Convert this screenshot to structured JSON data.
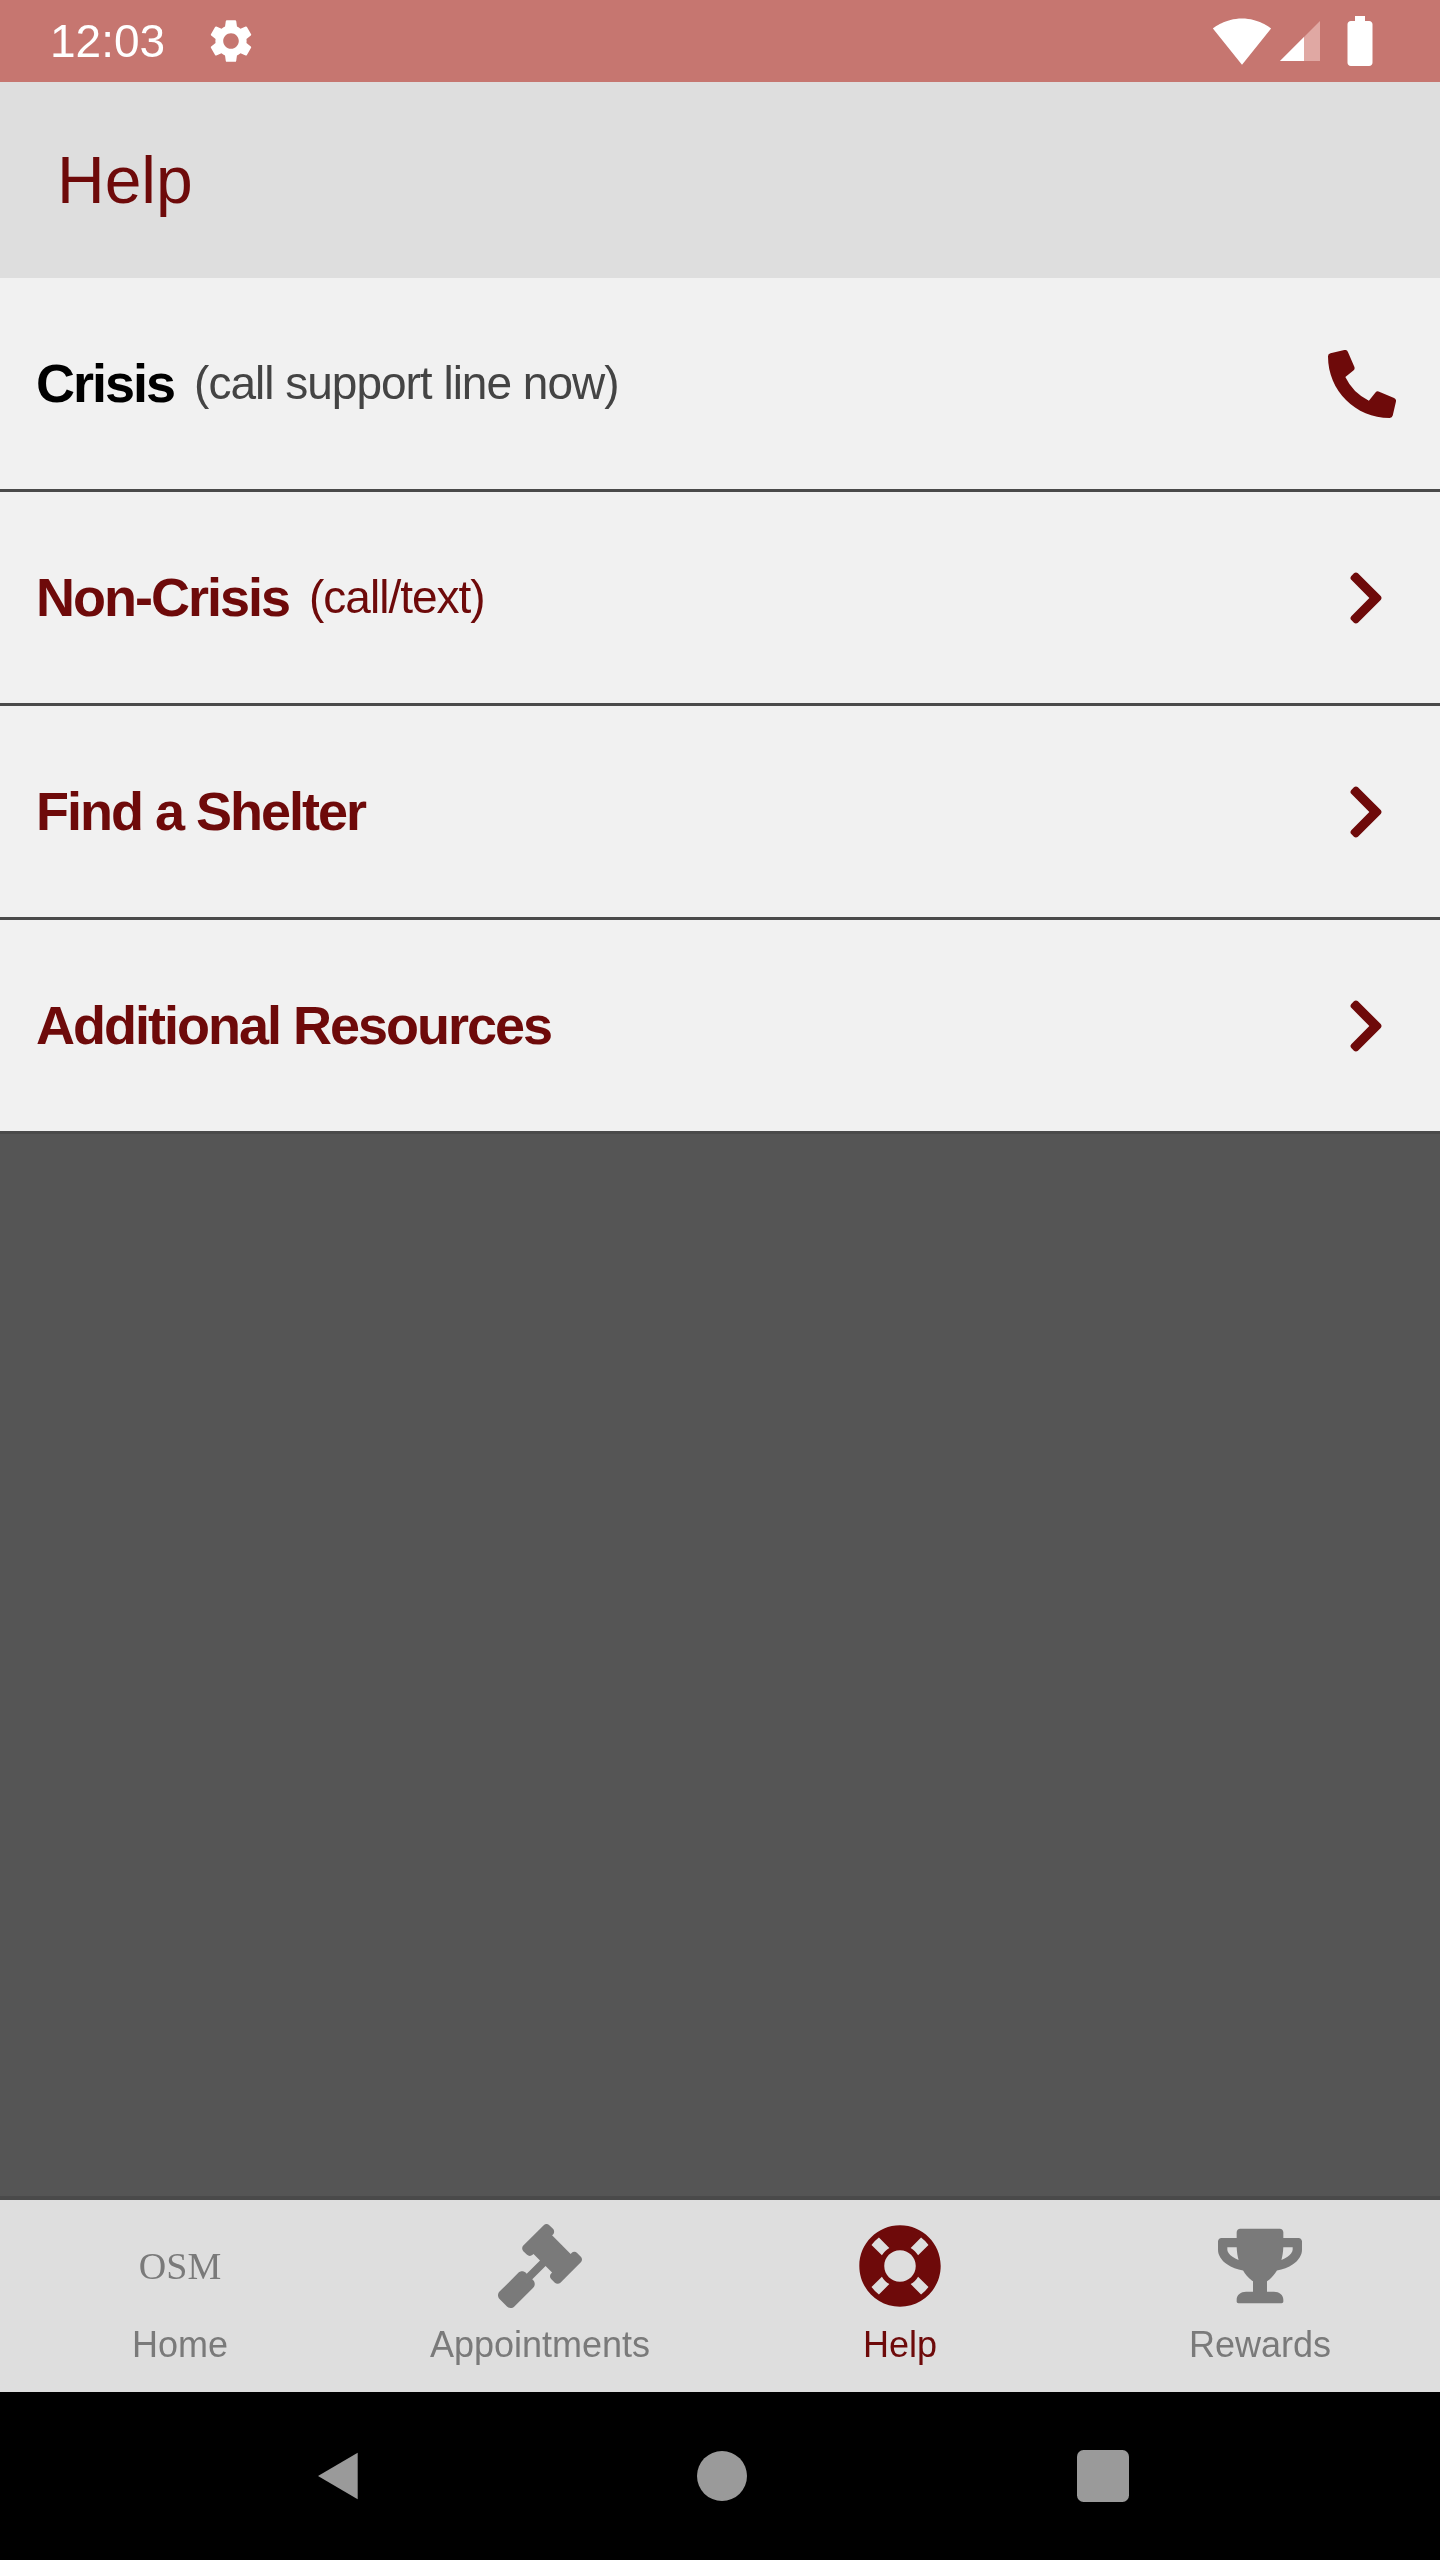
{
  "status_bar": {
    "time": "12:03"
  },
  "header": {
    "title": "Help"
  },
  "items": [
    {
      "kind": "call",
      "title": "Crisis",
      "subtitle": "(call support line now)"
    },
    {
      "kind": "link",
      "title": "Non-Crisis",
      "subtitle": "(call/text)"
    },
    {
      "kind": "link",
      "title": "Find a Shelter"
    },
    {
      "kind": "link",
      "title": "Additional Resources"
    }
  ],
  "bottom_nav": [
    {
      "kind": "text",
      "icon_text": "OSM",
      "label": "Home",
      "selected": false
    },
    {
      "kind": "gavel",
      "label": "Appointments",
      "selected": false
    },
    {
      "kind": "lifebuoy",
      "label": "Help",
      "selected": true
    },
    {
      "kind": "trophy",
      "label": "Rewards",
      "selected": false
    }
  ]
}
